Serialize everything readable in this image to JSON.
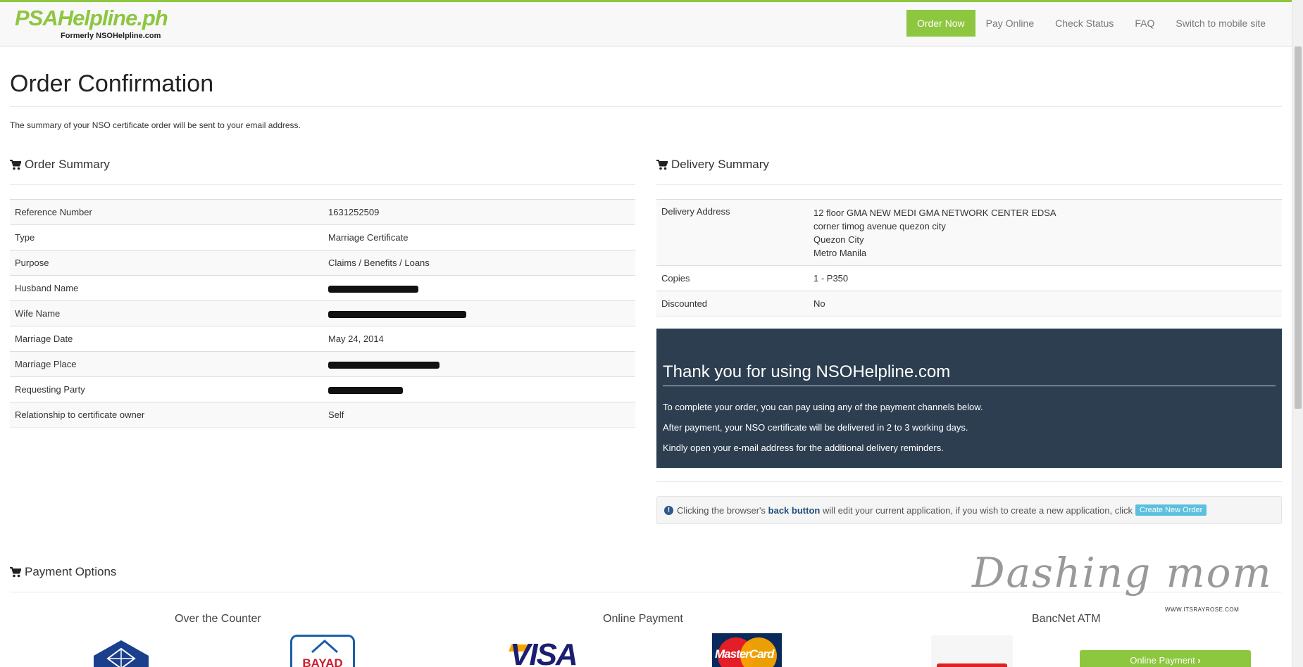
{
  "brand": {
    "logo_text": "PSAHelpline.ph",
    "logo_subtext": "Formerly NSOHelpline.com",
    "accent_color": "#8dc63f",
    "dark_panel_color": "#2c3e50"
  },
  "nav": {
    "items": [
      {
        "label": "Order Now",
        "active": true
      },
      {
        "label": "Pay Online"
      },
      {
        "label": "Check Status"
      },
      {
        "label": "FAQ"
      },
      {
        "label": "Switch to mobile site"
      }
    ]
  },
  "page": {
    "title": "Order Confirmation",
    "intro": "The summary of your NSO certificate order will be sent to your email address."
  },
  "order_summary": {
    "heading": "Order Summary",
    "icon": "cart-icon",
    "rows": [
      {
        "label": "Reference Number",
        "value": "1631252509"
      },
      {
        "label": "Type",
        "value": "Marriage Certificate"
      },
      {
        "label": "Purpose",
        "value": "Claims / Benefits / Loans"
      },
      {
        "label": "Husband Name",
        "value": ""
      },
      {
        "label": "Wife Name",
        "value": ""
      },
      {
        "label": "Marriage Date",
        "value": "May 24, 2014"
      },
      {
        "label": "Marriage Place",
        "value": ""
      },
      {
        "label": "Requesting Party",
        "value": ""
      },
      {
        "label": "Relationship to certificate owner",
        "value": "Self"
      }
    ]
  },
  "delivery_summary": {
    "heading": "Delivery Summary",
    "icon": "cart-icon",
    "address_label": "Delivery Address",
    "address_lines": [
      "12 floor GMA NEW MEDI GMA NETWORK CENTER EDSA",
      "corner timog avenue quezon city",
      "Quezon City",
      "Metro Manila"
    ],
    "copies_label": "Copies",
    "copies_value": "1 - P350",
    "discounted_label": "Discounted",
    "discounted_value": "No"
  },
  "thanks": {
    "title": "Thank you for using NSOHelpline.com",
    "line1": "To complete your order, you can pay using any of the payment channels below.",
    "line2": "After payment, your NSO certificate will be delivered in 2 to 3 working days.",
    "line3": "Kindly open your e-mail address for the additional delivery reminders."
  },
  "note": {
    "prefix": "Clicking the browser's",
    "bold": "back button",
    "suffix": "will edit your current application, if you wish to create a new application, click",
    "button": "Create New Order"
  },
  "payment": {
    "heading": "Payment Options",
    "icon": "cart-icon",
    "col1": "Over the Counter",
    "col2": "Online Payment",
    "col3": "BancNet ATM",
    "bayad_label": "BAYAD",
    "visa_label": "VISA",
    "mastercard_label": "MasterCard",
    "online_button": "Online Payment"
  },
  "watermark": {
    "text": "Dashing mom",
    "subtext": "WWW.ITSRAYROSE.COM"
  }
}
